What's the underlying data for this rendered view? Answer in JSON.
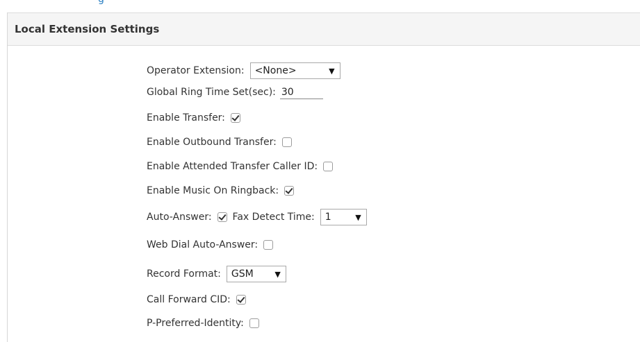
{
  "top_fragment": "g",
  "section": {
    "title": "Local Extension Settings"
  },
  "fields": {
    "operator_extension": {
      "label": "Operator Extension:",
      "value": "<None>"
    },
    "global_ring_time": {
      "label": "Global Ring Time Set(sec):",
      "value": "30"
    },
    "enable_transfer": {
      "label": "Enable Transfer:",
      "checked": true
    },
    "enable_outbound_transfer": {
      "label": "Enable Outbound Transfer:",
      "checked": false
    },
    "enable_attended_transfer_caller_id": {
      "label": "Enable Attended Transfer Caller ID:",
      "checked": false
    },
    "enable_music_on_ringback": {
      "label": "Enable Music On Ringback:",
      "checked": true
    },
    "auto_answer": {
      "label": "Auto-Answer:",
      "checked": true
    },
    "fax_detect_time": {
      "label": "Fax Detect Time:",
      "value": "1"
    },
    "web_dial_auto_answer": {
      "label": "Web Dial Auto-Answer:",
      "checked": false
    },
    "record_format": {
      "label": "Record Format:",
      "value": "GSM"
    },
    "call_forward_cid": {
      "label": "Call Forward CID:",
      "checked": true
    },
    "p_preferred_identity": {
      "label": "P-Preferred-Identity:",
      "checked": false
    }
  },
  "icons": {
    "dropdown": "triangle-down"
  }
}
